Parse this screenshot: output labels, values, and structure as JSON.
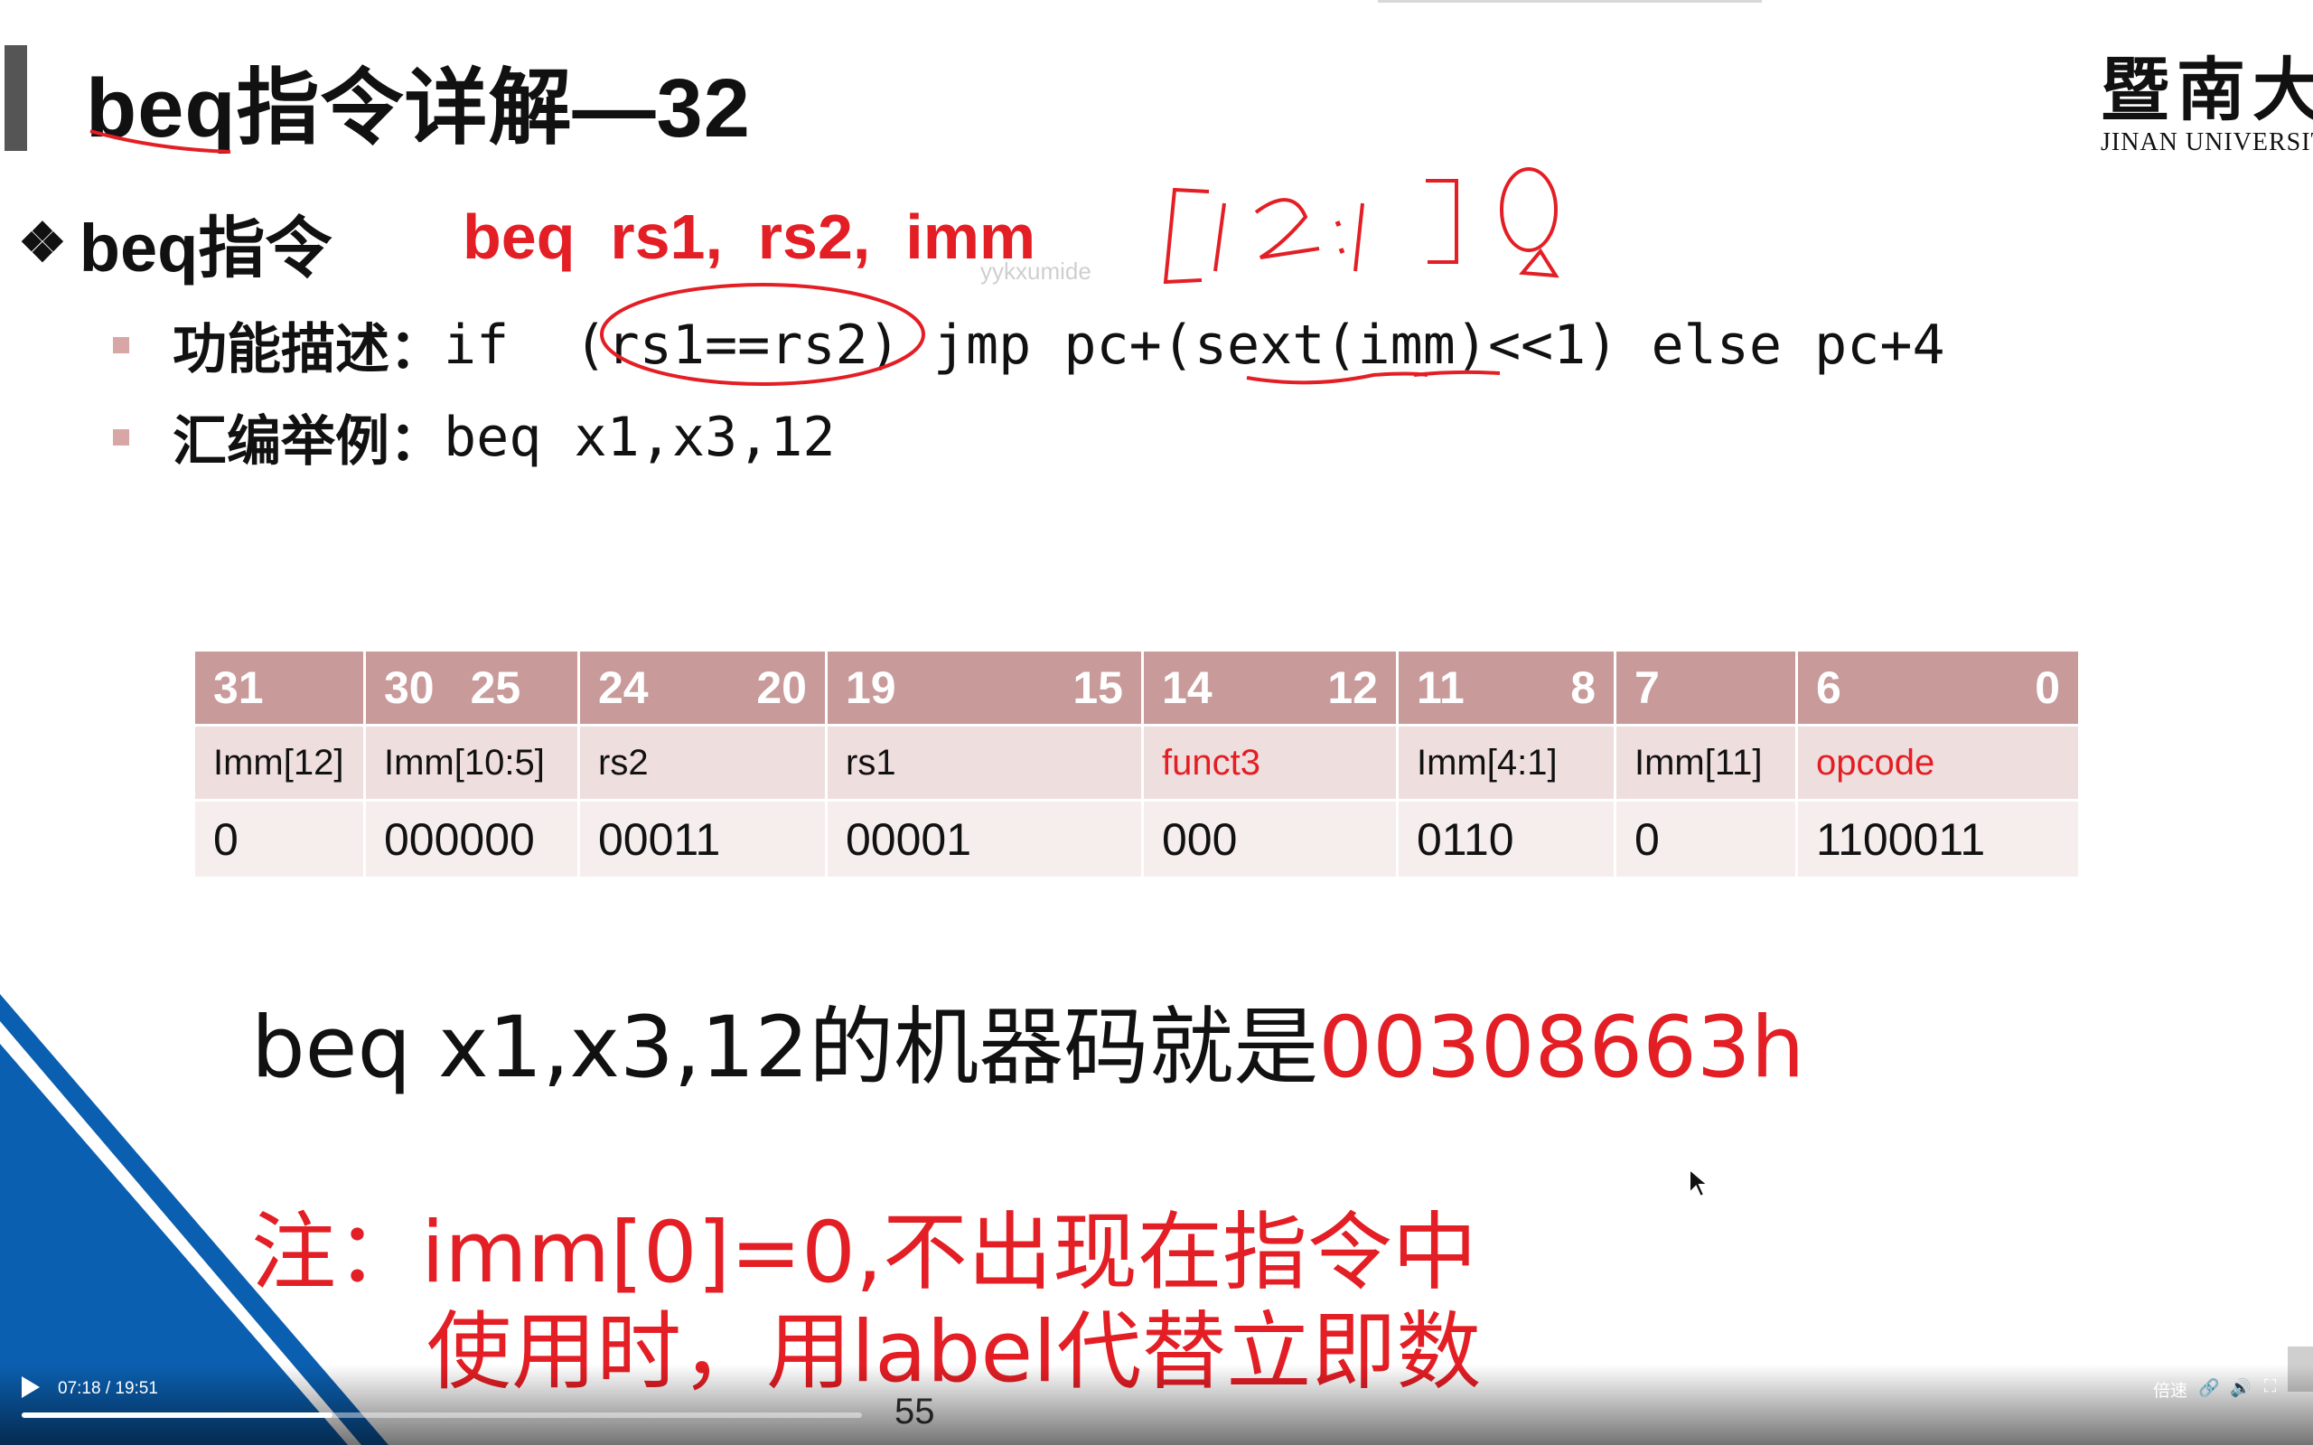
{
  "slide": {
    "title": "beq指令详解—32",
    "logo_cn": "暨南大学",
    "logo_en": "JINAN UNIVERSITY",
    "bullet_label": "beq指令",
    "syntax": "beq  rs1,  rs2,  imm",
    "desc_label": "功能描述：",
    "desc_code": "if  (rs1==rs2) jmp pc+(sext(imm)<<1) else pc+4",
    "example_label": "汇编举例：",
    "example_code": "beq x1,x3,12",
    "watermark": "yykxumide",
    "page_number": "55"
  },
  "encoding_table": {
    "headers": [
      {
        "left": "31",
        "right": ""
      },
      {
        "left": "30",
        "right": "25"
      },
      {
        "left": "24",
        "right": "20"
      },
      {
        "left": "19",
        "right": "15"
      },
      {
        "left": "14",
        "right": "12"
      },
      {
        "left": "11",
        "right": "8"
      },
      {
        "left": "7",
        "right": ""
      },
      {
        "left": "6",
        "right": "0"
      }
    ],
    "fields": [
      "Imm[12]",
      "Imm[10:5]",
      "rs2",
      "rs1",
      "funct3",
      "Imm[4:1]",
      "Imm[11]",
      "opcode"
    ],
    "values": [
      "0",
      "000000",
      "00011",
      "00001",
      "000",
      "0110",
      "0",
      "1100011"
    ]
  },
  "machine_code": {
    "text": "beq x1,x3,12的机器码就是",
    "hex": "00308663h"
  },
  "note": {
    "line1": "注：imm[0]=0,不出现在指令中",
    "line2": "使用时，用label代替立即数"
  },
  "player": {
    "time": "07:18 / 19:51",
    "progress": 0.37,
    "speed_label": "倍速"
  },
  "colors": {
    "accent_red": "#e31e24",
    "table_header": "#c99a9a",
    "corner_blue": "#0b5fb0"
  }
}
